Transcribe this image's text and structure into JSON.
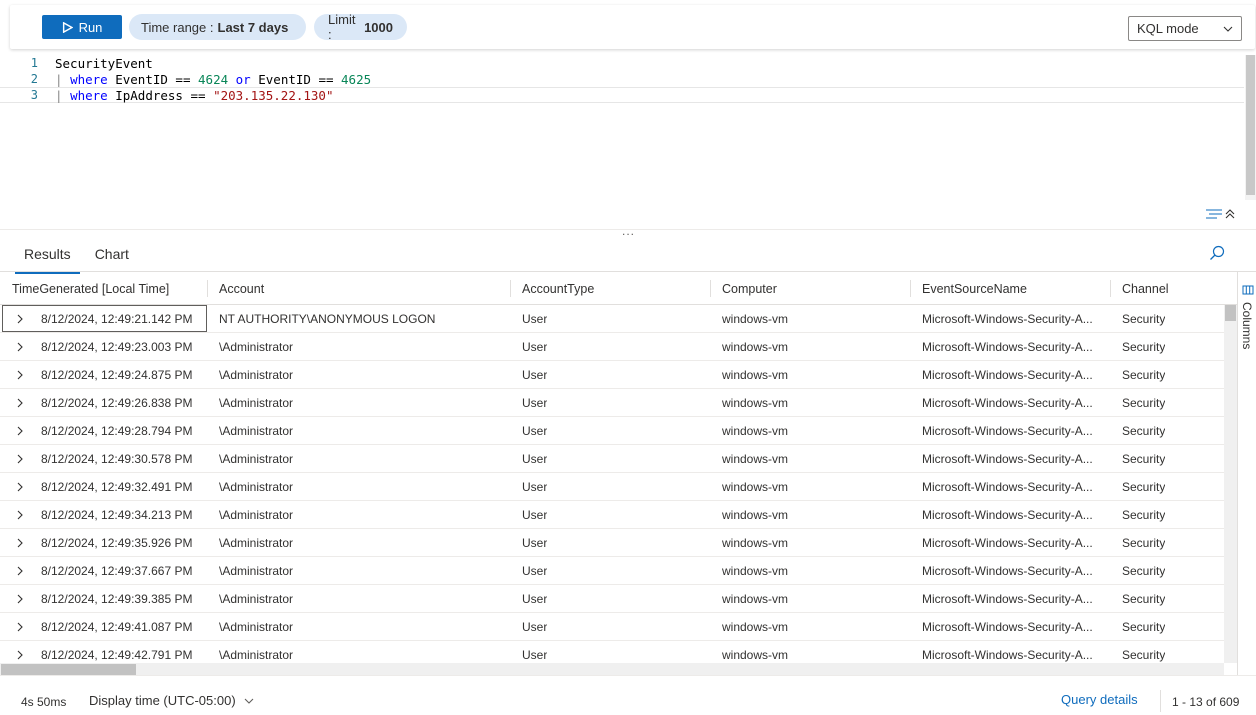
{
  "toolbar": {
    "run_label": "Run",
    "time_range_label": "Time range :",
    "time_range_value": "Last 7 days",
    "limit_label": "Limit :",
    "limit_value": "1000",
    "mode_value": "KQL mode"
  },
  "editor": {
    "lines": [
      {
        "num": "1",
        "text": "SecurityEvent"
      },
      {
        "num": "2",
        "text": "| where EventID == 4624 or EventID == 4625"
      },
      {
        "num": "3",
        "text": "| where IpAddress == \"203.135.22.130\""
      }
    ]
  },
  "splitter": {
    "dots": "..."
  },
  "tabs": {
    "results": "Results",
    "chart": "Chart"
  },
  "table": {
    "headers": [
      "TimeGenerated [Local Time]",
      "Account",
      "AccountType",
      "Computer",
      "EventSourceName",
      "Channel"
    ],
    "rows": [
      [
        "8/12/2024, 12:49:21.142 PM",
        "NT AUTHORITY\\ANONYMOUS LOGON",
        "User",
        "windows-vm",
        "Microsoft-Windows-Security-A...",
        "Security"
      ],
      [
        "8/12/2024, 12:49:23.003 PM",
        "\\Administrator",
        "User",
        "windows-vm",
        "Microsoft-Windows-Security-A...",
        "Security"
      ],
      [
        "8/12/2024, 12:49:24.875 PM",
        "\\Administrator",
        "User",
        "windows-vm",
        "Microsoft-Windows-Security-A...",
        "Security"
      ],
      [
        "8/12/2024, 12:49:26.838 PM",
        "\\Administrator",
        "User",
        "windows-vm",
        "Microsoft-Windows-Security-A...",
        "Security"
      ],
      [
        "8/12/2024, 12:49:28.794 PM",
        "\\Administrator",
        "User",
        "windows-vm",
        "Microsoft-Windows-Security-A...",
        "Security"
      ],
      [
        "8/12/2024, 12:49:30.578 PM",
        "\\Administrator",
        "User",
        "windows-vm",
        "Microsoft-Windows-Security-A...",
        "Security"
      ],
      [
        "8/12/2024, 12:49:32.491 PM",
        "\\Administrator",
        "User",
        "windows-vm",
        "Microsoft-Windows-Security-A...",
        "Security"
      ],
      [
        "8/12/2024, 12:49:34.213 PM",
        "\\Administrator",
        "User",
        "windows-vm",
        "Microsoft-Windows-Security-A...",
        "Security"
      ],
      [
        "8/12/2024, 12:49:35.926 PM",
        "\\Administrator",
        "User",
        "windows-vm",
        "Microsoft-Windows-Security-A...",
        "Security"
      ],
      [
        "8/12/2024, 12:49:37.667 PM",
        "\\Administrator",
        "User",
        "windows-vm",
        "Microsoft-Windows-Security-A...",
        "Security"
      ],
      [
        "8/12/2024, 12:49:39.385 PM",
        "\\Administrator",
        "User",
        "windows-vm",
        "Microsoft-Windows-Security-A...",
        "Security"
      ],
      [
        "8/12/2024, 12:49:41.087 PM",
        "\\Administrator",
        "User",
        "windows-vm",
        "Microsoft-Windows-Security-A...",
        "Security"
      ],
      [
        "8/12/2024, 12:49:42.791 PM",
        "\\Administrator",
        "User",
        "windows-vm",
        "Microsoft-Windows-Security-A...",
        "Security"
      ]
    ]
  },
  "side_panel": {
    "columns_label": "Columns"
  },
  "footer": {
    "duration": "4s 50ms",
    "display_time": "Display time (UTC-05:00)",
    "query_details": "Query details",
    "count": "1 - 13 of 609"
  },
  "colors": {
    "accent": "#0f6cbd",
    "pill": "#dbe8f7",
    "keyword": "#0000ff",
    "number": "#098658",
    "string": "#a31515"
  },
  "icons": [
    "play-icon",
    "chevron-down-icon",
    "wrap-icon",
    "collapse-icon",
    "search-icon",
    "expand-row-icon",
    "columns-icon"
  ]
}
